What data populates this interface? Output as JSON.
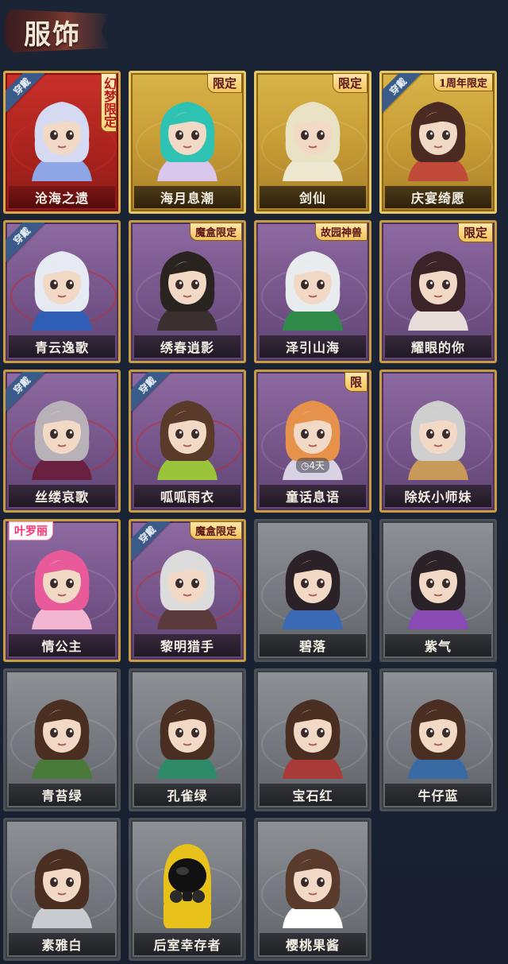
{
  "header": {
    "title": "服饰"
  },
  "colors": {
    "background": "#1a2233",
    "worn_tag": "#3a5b8a",
    "red_frame": "#c9302a",
    "gold_frame": "#d8b449",
    "purple_frame": "#8d6aa1",
    "gray_frame": "#8e9196"
  },
  "costumes": [
    {
      "name": "沧海之遗",
      "tier": "red",
      "worn_label": "穿戴",
      "badge": "幻梦限定",
      "hair": "#d6d9f2",
      "shirt": "#8fa6e6",
      "icon": "costume-portrait-icon"
    },
    {
      "name": "海月息潮",
      "tier": "gold",
      "worn_label": "",
      "badge": "限定",
      "hair": "#2ec2b3",
      "shirt": "#d9c7ee",
      "icon": "costume-portrait-icon"
    },
    {
      "name": "剑仙",
      "tier": "gold",
      "worn_label": "",
      "badge": "限定",
      "hair": "#e9e2c4",
      "shirt": "#efe8d0",
      "icon": "costume-portrait-icon"
    },
    {
      "name": "庆宴绮愿",
      "tier": "gold",
      "worn_label": "穿戴",
      "badge": "1周年限定",
      "hair": "#4a2a22",
      "shirt": "#c24a3a",
      "icon": "costume-portrait-icon"
    },
    {
      "name": "青云逸歌",
      "tier": "purple",
      "worn_label": "穿戴",
      "badge": "",
      "hair": "#e6eaf2",
      "shirt": "#2f5fb6",
      "icon": "costume-portrait-icon"
    },
    {
      "name": "绣春逍影",
      "tier": "purple",
      "worn_label": "",
      "badge": "魔盒限定",
      "hair": "#2a2420",
      "shirt": "#3a3030",
      "icon": "costume-portrait-icon"
    },
    {
      "name": "泽引山海",
      "tier": "purple",
      "worn_label": "",
      "badge": "故园神兽",
      "hair": "#e8ecef",
      "shirt": "#2f8a4a",
      "icon": "costume-portrait-icon"
    },
    {
      "name": "耀眼的你",
      "tier": "purple",
      "worn_label": "",
      "badge": "限定",
      "hair": "#3a2428",
      "shirt": "#e7dcd8",
      "icon": "costume-portrait-icon"
    },
    {
      "name": "丝缕哀歌",
      "tier": "purple",
      "worn_label": "穿戴",
      "badge": "",
      "hair": "#b8b2b8",
      "shirt": "#6a2040",
      "icon": "costume-portrait-icon"
    },
    {
      "name": "呱呱雨衣",
      "tier": "purple",
      "worn_label": "穿戴",
      "badge": "",
      "hair": "#5a3a28",
      "shirt": "#9ac43a",
      "icon": "costume-portrait-icon"
    },
    {
      "name": "童话息语",
      "tier": "purple",
      "worn_label": "",
      "badge": "限",
      "hair": "#e6924a",
      "shirt": "#d8d2e4",
      "timer": "4天",
      "icon": "costume-portrait-icon"
    },
    {
      "name": "除妖小师妹",
      "tier": "purple",
      "worn_label": "",
      "badge": "",
      "hair": "#cfcfcf",
      "shirt": "#c79a5a",
      "icon": "costume-portrait-icon"
    },
    {
      "name": "情公主",
      "tier": "purple",
      "worn_label": "",
      "badge": "叶罗丽",
      "hair": "#e85a9a",
      "shirt": "#f2b6d0",
      "icon": "costume-portrait-icon"
    },
    {
      "name": "黎明猎手",
      "tier": "purple",
      "worn_label": "穿戴",
      "badge": "魔盒限定",
      "hair": "#dcdcdc",
      "shirt": "#5a3a3a",
      "icon": "costume-portrait-icon"
    },
    {
      "name": "碧落",
      "tier": "gray",
      "worn_label": "",
      "badge": "",
      "hair": "#2a2226",
      "shirt": "#3a6ab4",
      "icon": "costume-portrait-icon"
    },
    {
      "name": "紫气",
      "tier": "gray",
      "worn_label": "",
      "badge": "",
      "hair": "#2a2226",
      "shirt": "#8a4ab4",
      "icon": "costume-portrait-icon"
    },
    {
      "name": "青苔绿",
      "tier": "gray",
      "worn_label": "",
      "badge": "",
      "hair": "#4a2e22",
      "shirt": "#4a7a3a",
      "icon": "costume-portrait-icon"
    },
    {
      "name": "孔雀绿",
      "tier": "gray",
      "worn_label": "",
      "badge": "",
      "hair": "#4a2e22",
      "shirt": "#2f8a6a",
      "icon": "costume-portrait-icon"
    },
    {
      "name": "宝石红",
      "tier": "gray",
      "worn_label": "",
      "badge": "",
      "hair": "#4a2e22",
      "shirt": "#a83a3a",
      "icon": "costume-portrait-icon"
    },
    {
      "name": "牛仔蓝",
      "tier": "gray",
      "worn_label": "",
      "badge": "",
      "hair": "#4a2e22",
      "shirt": "#3a6aa4",
      "icon": "costume-portrait-icon"
    },
    {
      "name": "素雅白",
      "tier": "gray",
      "worn_label": "",
      "badge": "",
      "hair": "#4a2e22",
      "shirt": "#c8ccd0",
      "icon": "costume-portrait-icon"
    },
    {
      "name": "后室幸存者",
      "tier": "gray",
      "worn_label": "",
      "badge": "",
      "hair": "#e8c21a",
      "shirt": "#e8c21a",
      "icon": "gas-mask-icon"
    },
    {
      "name": "樱桃果酱",
      "tier": "gray",
      "worn_label": "",
      "badge": "",
      "hair": "#5a3a2a",
      "shirt": "#ffffff",
      "icon": "costume-portrait-icon"
    }
  ]
}
